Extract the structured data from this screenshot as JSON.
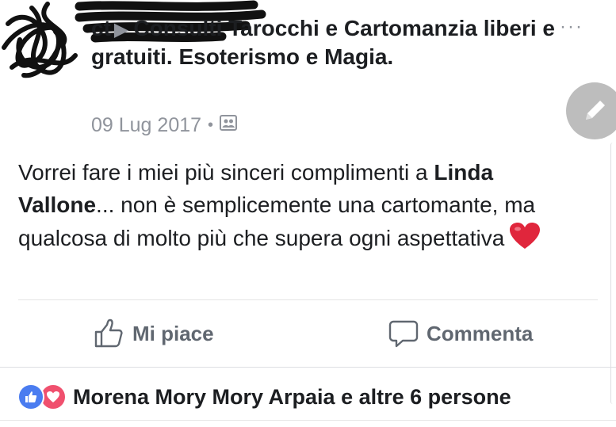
{
  "header": {
    "name_partial": "ct",
    "group_name": "Consulti Tarocchi e Cartomanzia liberi e gratuiti. Esoterismo e Magia."
  },
  "meta": {
    "date": "09 Lug 2017",
    "separator": "•",
    "privacy_icon": "group-photo-icon"
  },
  "menu_icon": "more-dots-icon",
  "fab_icon": "pencil-icon",
  "post": {
    "text_1": "Vorrei fare i miei più sinceri complimenti a ",
    "mention": "Linda Vallone",
    "text_2": "... non è semplicemente una cartomante, ma qualcosa di molto più che supera ogni aspettativa",
    "emoji": "heart"
  },
  "actions": {
    "like_label": "Mi piace",
    "comment_label": "Commenta"
  },
  "reactions": {
    "text": "Morena Mory Mory Arpaia e altre 6 persone"
  },
  "colors": {
    "text": "#1c1e21",
    "muted": "#90949c",
    "like_blue": "#4a7cf0",
    "love_red": "#f0506e"
  }
}
